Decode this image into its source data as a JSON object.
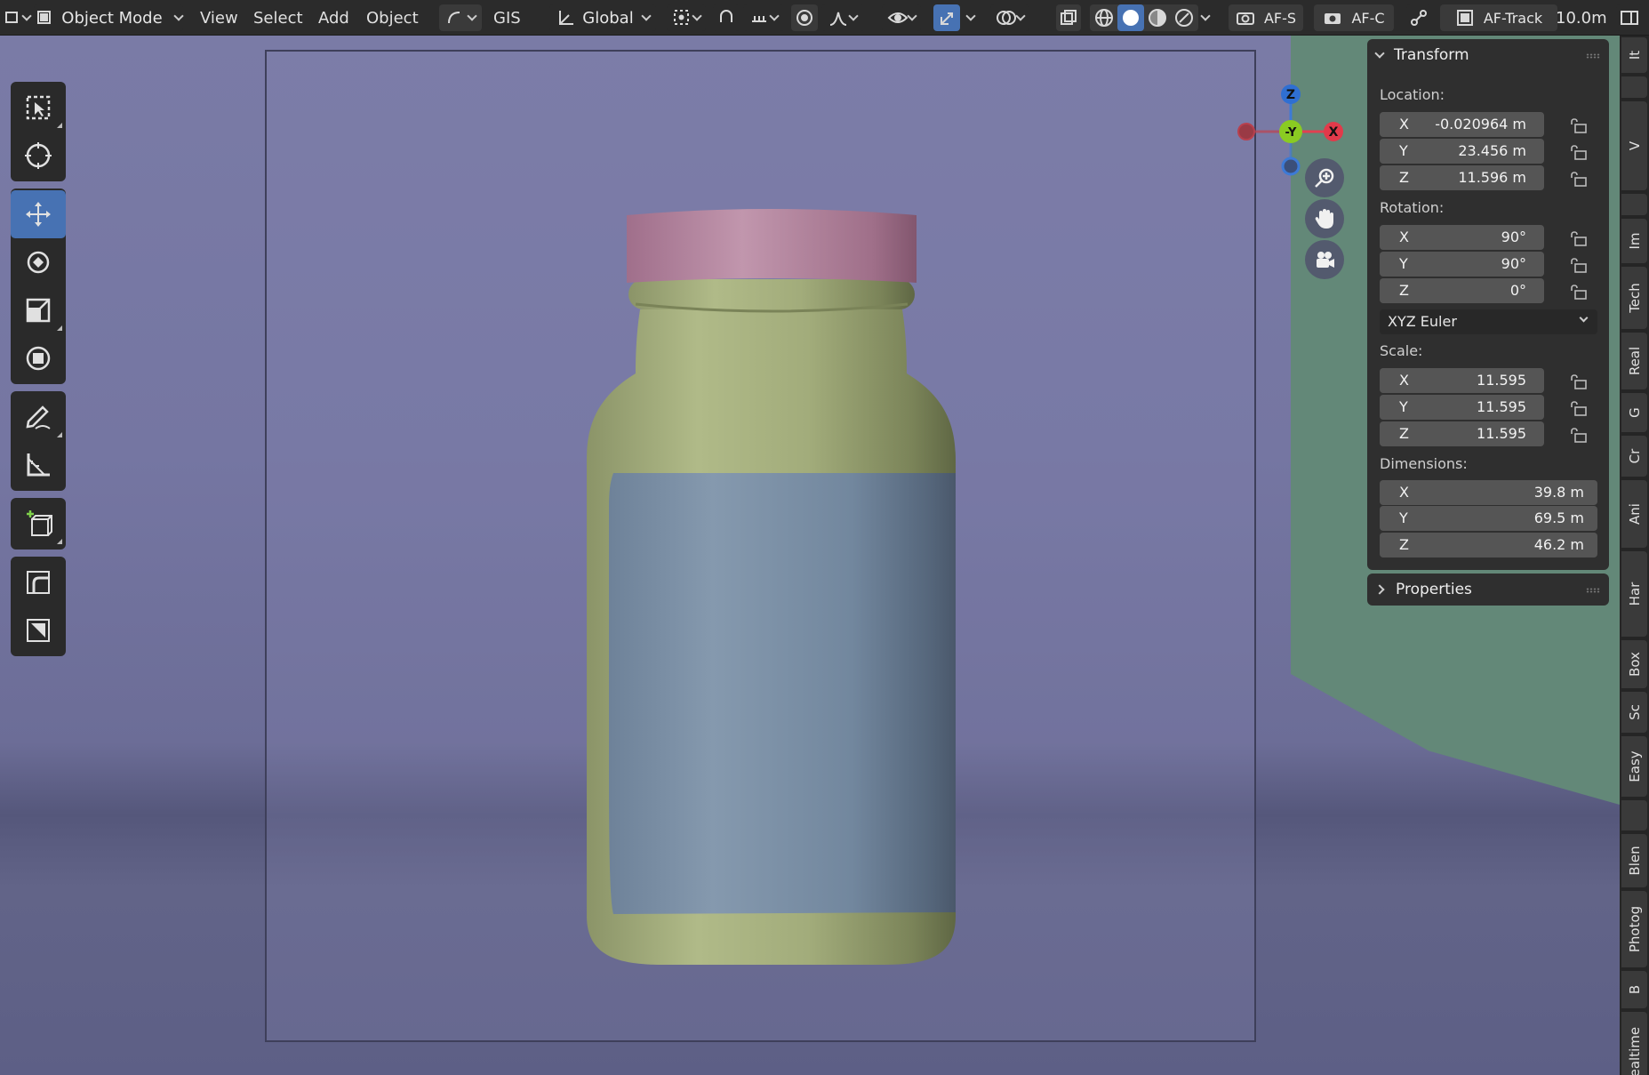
{
  "header": {
    "mode": "Object Mode",
    "menus": [
      "View",
      "Select",
      "Add",
      "Object"
    ],
    "gis": "GIS",
    "orientation": "Global",
    "af_s": "AF-S",
    "af_c": "AF-C",
    "af_track": "AF-Track",
    "distance": "10.0m"
  },
  "gizmo": {
    "z": "Z",
    "y": "-Y",
    "x": "X"
  },
  "transform": {
    "title": "Transform",
    "location_label": "Location:",
    "location": [
      {
        "axis": "X",
        "value": "-0.020964 m"
      },
      {
        "axis": "Y",
        "value": "23.456 m"
      },
      {
        "axis": "Z",
        "value": "11.596 m"
      }
    ],
    "rotation_label": "Rotation:",
    "rotation": [
      {
        "axis": "X",
        "value": "90°"
      },
      {
        "axis": "Y",
        "value": "90°"
      },
      {
        "axis": "Z",
        "value": "0°"
      }
    ],
    "rotation_mode": "XYZ Euler",
    "scale_label": "Scale:",
    "scale": [
      {
        "axis": "X",
        "value": "11.595"
      },
      {
        "axis": "Y",
        "value": "11.595"
      },
      {
        "axis": "Z",
        "value": "11.595"
      }
    ],
    "dimensions_label": "Dimensions:",
    "dimensions": [
      {
        "axis": "X",
        "value": "39.8 m"
      },
      {
        "axis": "Y",
        "value": "69.5 m"
      },
      {
        "axis": "Z",
        "value": "46.2 m"
      }
    ]
  },
  "properties": {
    "title": "Properties"
  },
  "sidetabs": [
    "It",
    "V",
    "Im",
    "Tech",
    "Real",
    "G",
    "Cr",
    "Ani",
    "Har",
    "Box",
    "Sc",
    "Easy",
    "Blen",
    "Photog",
    "B",
    "Realtime"
  ],
  "colors": {
    "accent": "#4772b3",
    "bottle_body": "#a3ad7c",
    "bottle_cap": "#b8839e",
    "bottle_label": "#7a8fa5",
    "plane": "#638878"
  }
}
